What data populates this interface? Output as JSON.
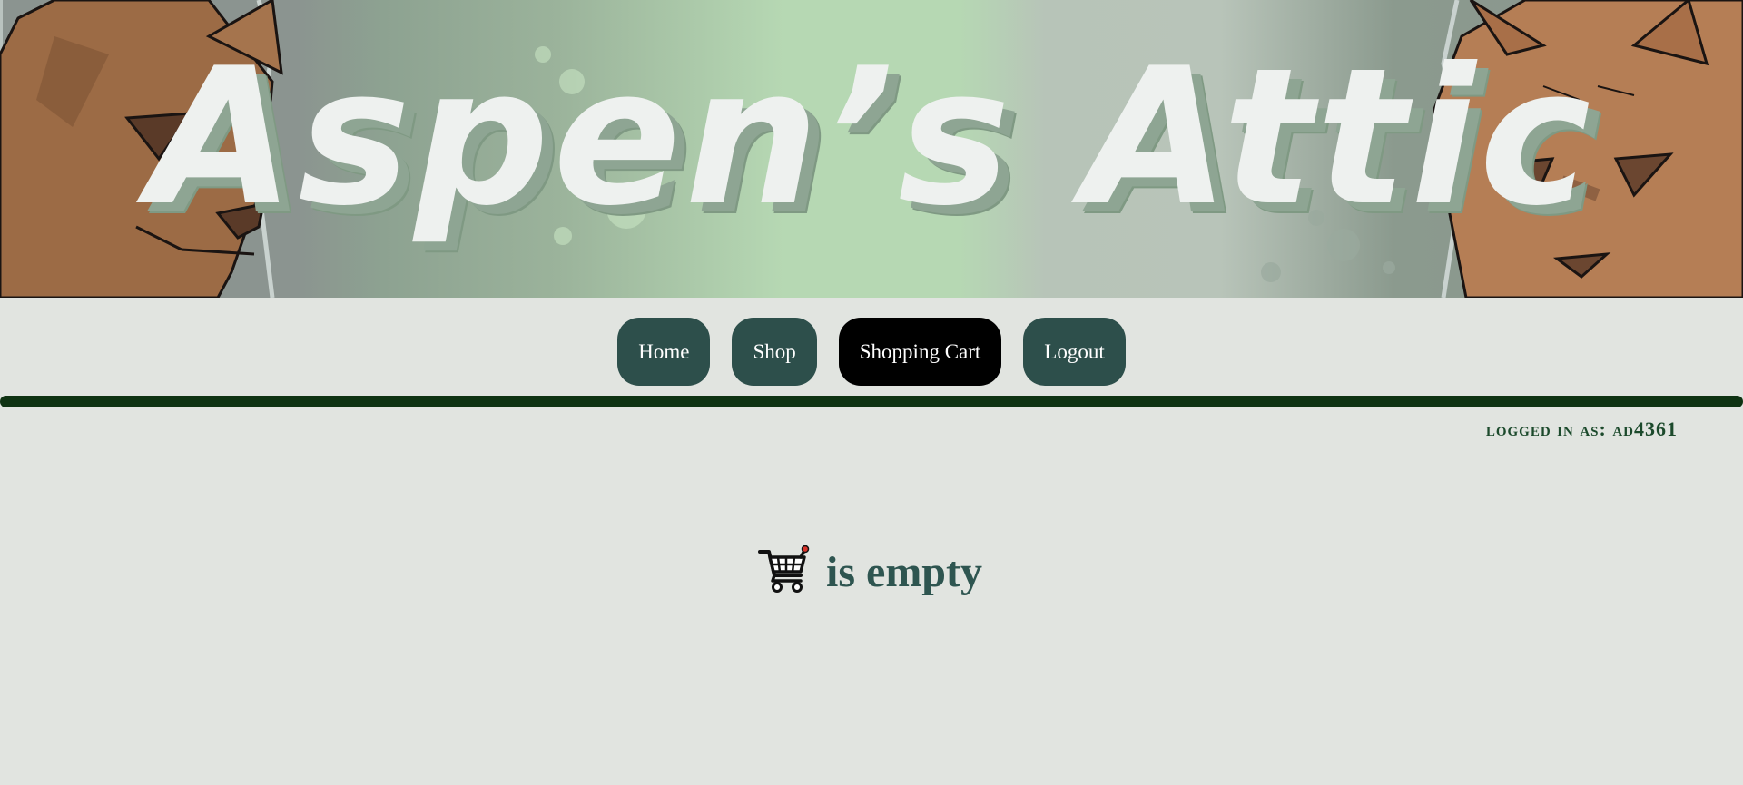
{
  "banner": {
    "title": "Aspen’s Attic"
  },
  "nav": {
    "items": [
      {
        "label": "Home"
      },
      {
        "label": "Shop"
      },
      {
        "label": "Shopping Cart",
        "active": true
      },
      {
        "label": "Logout"
      }
    ]
  },
  "user": {
    "login_status": "logged in as: ad4361"
  },
  "cart": {
    "icon": "shopping-cart-icon",
    "empty_text": "is empty"
  },
  "colors": {
    "background": "#e1e4e0",
    "nav_button": "#2d4f4b",
    "nav_button_active": "#000000",
    "divider": "#0f3313",
    "accent_text": "#2e5550"
  }
}
